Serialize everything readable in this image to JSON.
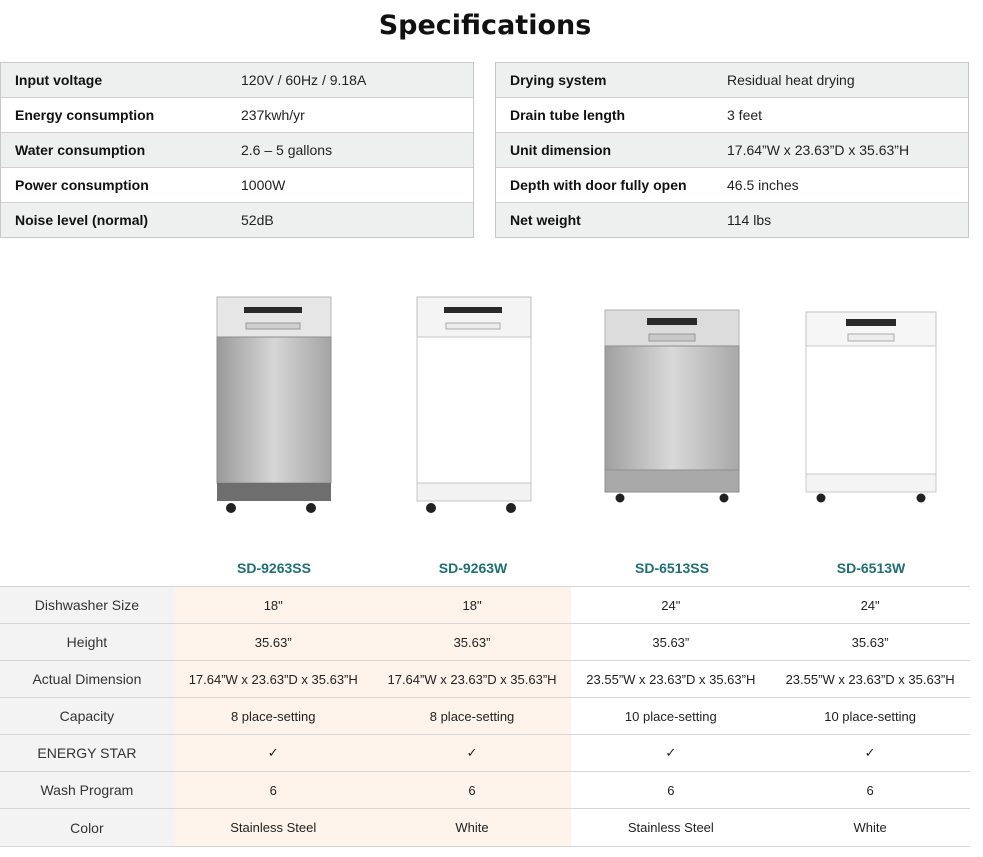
{
  "title": "Specifications",
  "specs_left": [
    {
      "label": "Input voltage",
      "value": "120V / 60Hz / 9.18A"
    },
    {
      "label": "Energy consumption",
      "value": "237kwh/yr"
    },
    {
      "label": "Water consumption",
      "value": "2.6 – 5 gallons"
    },
    {
      "label": "Power consumption",
      "value": "1000W"
    },
    {
      "label": "Noise level (normal)",
      "value": "52dB"
    }
  ],
  "specs_right": [
    {
      "label": "Drying system",
      "value": "Residual heat drying"
    },
    {
      "label": "Drain tube length",
      "value": "3 feet"
    },
    {
      "label": "Unit dimension",
      "value": "17.64”W x 23.63”D x 35.63”H"
    },
    {
      "label": "Depth with door fully open",
      "value": "46.5 inches"
    },
    {
      "label": "Net weight",
      "value": "114 lbs"
    }
  ],
  "models": [
    "SD-9263SS",
    "SD-9263W",
    "SD-6513SS",
    "SD-6513W"
  ],
  "model_finishes": [
    "stainless",
    "white",
    "stainless",
    "white"
  ],
  "comparison": [
    {
      "label": "Dishwasher Size",
      "values": [
        "18\"",
        "18\"",
        "24\"",
        "24\""
      ]
    },
    {
      "label": "Height",
      "values": [
        "35.63”",
        "35.63”",
        "35.63”",
        "35.63”"
      ]
    },
    {
      "label": "Actual Dimension",
      "values": [
        "17.64”W x 23.63”D x 35.63”H",
        "17.64”W x 23.63”D x 35.63”H",
        "23.55”W x 23.63”D x 35.63”H",
        "23.55”W x 23.63”D x 35.63”H"
      ]
    },
    {
      "label": "Capacity",
      "values": [
        "8 place-setting",
        "8 place-setting",
        "10 place-setting",
        "10 place-setting"
      ]
    },
    {
      "label": "ENERGY STAR",
      "values": [
        "✓",
        "✓",
        "✓",
        "✓"
      ]
    },
    {
      "label": "Wash Program",
      "values": [
        "6",
        "6",
        "6",
        "6"
      ]
    },
    {
      "label": "Color",
      "values": [
        "Stainless Steel",
        "White",
        "Stainless Steel",
        "White"
      ]
    }
  ],
  "colors": {
    "accent": "#1f6f74",
    "highlight": "#fdf3ea",
    "label_bg": "#f3f3f3",
    "spec_shade": "#eef0ef"
  }
}
